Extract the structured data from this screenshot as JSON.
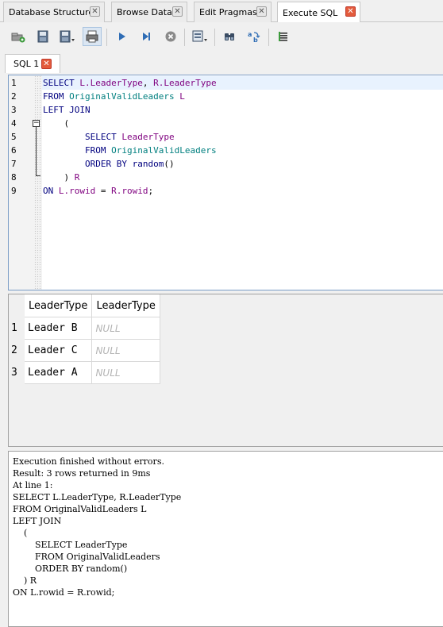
{
  "main_tabs": [
    {
      "label": "Database Structure"
    },
    {
      "label": "Browse Data"
    },
    {
      "label": "Edit Pragmas"
    },
    {
      "label": "Execute SQL"
    }
  ],
  "sql_tab": {
    "label": "SQL 1"
  },
  "editor": {
    "line_numbers": [
      "1",
      "2",
      "3",
      "4",
      "5",
      "6",
      "7",
      "8",
      "9"
    ]
  },
  "results": {
    "columns": [
      "LeaderType",
      "LeaderType"
    ],
    "rows": [
      {
        "num": "1",
        "c1": "Leader B",
        "c2": "NULL"
      },
      {
        "num": "2",
        "c1": "Leader C",
        "c2": "NULL"
      },
      {
        "num": "3",
        "c1": "Leader A",
        "c2": "NULL"
      }
    ]
  },
  "log": {
    "text": "Execution finished without errors.\nResult: 3 rows returned in 9ms\nAt line 1:\nSELECT L.LeaderType, R.LeaderType\nFROM OriginalValidLeaders L\nLEFT JOIN\n    (\n        SELECT LeaderType\n        FROM OriginalValidLeaders\n        ORDER BY random()\n    ) R\nON L.rowid = R.rowid;"
  },
  "colors": {
    "accent_close": "#e35b3c",
    "editor_border": "#7a9cc6",
    "highlight_line": "#e8f2fe"
  }
}
